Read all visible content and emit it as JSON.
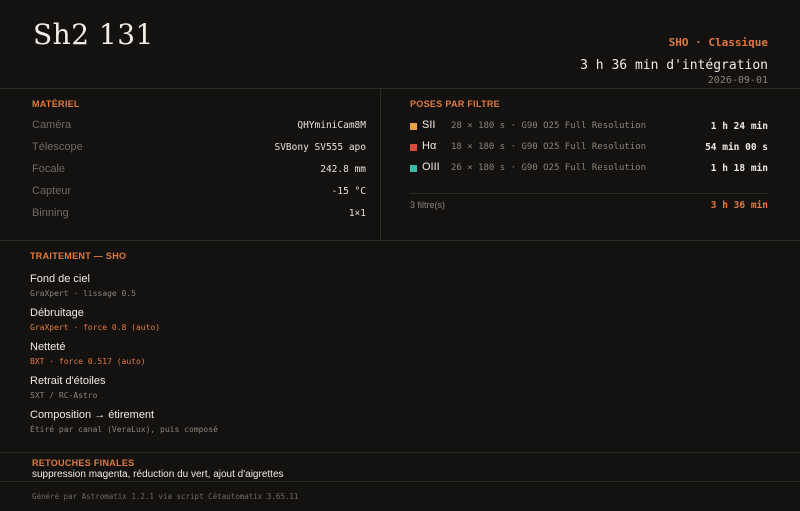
{
  "header": {
    "title": "Sh2 131",
    "mode": "SHO · Classique",
    "total": "3 h 36 min d'intégration",
    "date": "2026-09-01"
  },
  "materiel": {
    "title": "MATÉRIEL",
    "rows": [
      {
        "label": "Caméra",
        "value": "QHYminiCam8M"
      },
      {
        "label": "Télescope",
        "value": "SVBony SV555 apo"
      },
      {
        "label": "Focale",
        "value": "242.8 mm"
      },
      {
        "label": "Capteur",
        "value": "-15 °C"
      },
      {
        "label": "Binning",
        "value": "1×1"
      }
    ]
  },
  "poses": {
    "title": "POSES PAR FILTRE",
    "filters": [
      {
        "name": "SII",
        "color": "#e8a040",
        "detail": "28 × 180 s · G90 O25 Full Resolution",
        "time": "1 h 24 min"
      },
      {
        "name": "Hα",
        "color": "#d84a3c",
        "detail": "18 × 180 s · G90 O25 Full Resolution",
        "time": "54 min 00 s"
      },
      {
        "name": "OIII",
        "color": "#3ab8a8",
        "detail": "26 × 180 s · G90 O25 Full Resolution",
        "time": "1 h 18 min"
      }
    ],
    "count": "3 filtre(s)",
    "total": "3 h 36 min"
  },
  "traitement": {
    "title": "TRAITEMENT — SHO",
    "steps": [
      {
        "name": "Fond de ciel",
        "detail": "GraXpert · lissage 0.5",
        "accent": false
      },
      {
        "name": "Débruitage",
        "detail": "GraXpert · force 0.8 (auto)",
        "accent": true
      },
      {
        "name": "Netteté",
        "detail": "BXT · force 0.517 (auto)",
        "accent": true
      },
      {
        "name": "Retrait d'étoiles",
        "detail": "SXT / RC-Astro",
        "accent": false
      },
      {
        "name": "Composition → étirement",
        "detail": "Étiré par canal (VeraLux), puis composé",
        "accent": false
      }
    ]
  },
  "retouches": {
    "title": "RETOUCHES FINALES",
    "text": "suppression magenta, réduction du vert, ajout d'aigrettes"
  },
  "footer": "Généré par Astromatix 1.2.1 via script Cétautomatix 3.65.11"
}
